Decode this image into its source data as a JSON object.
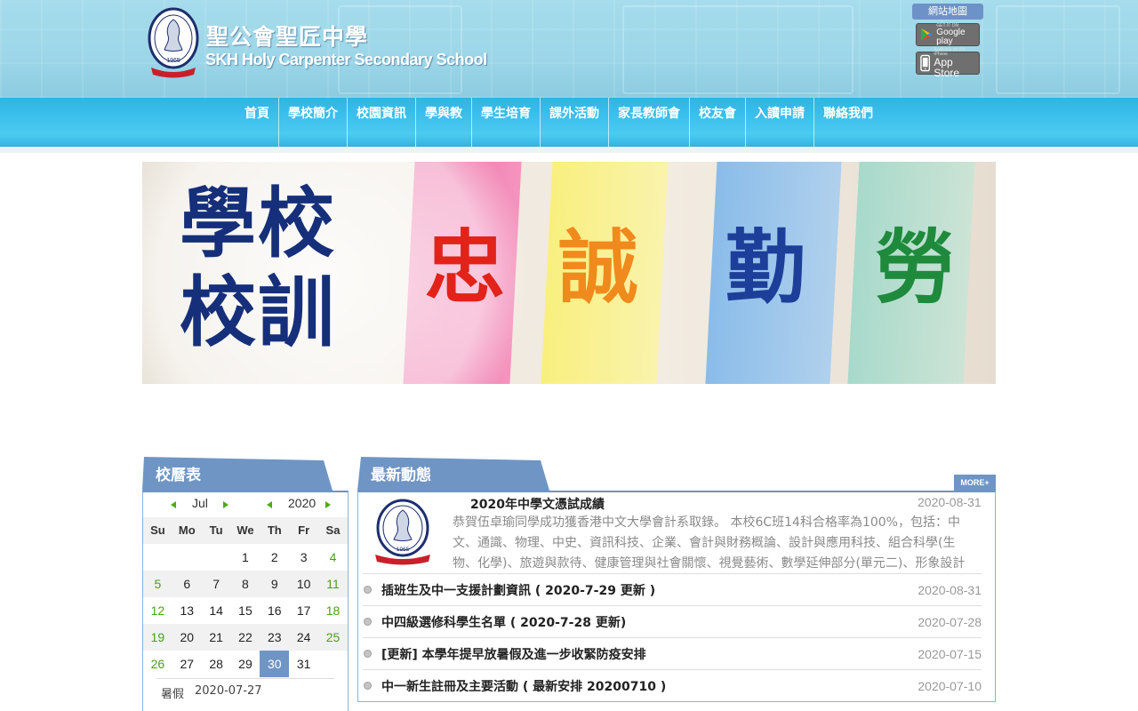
{
  "header": {
    "school_name_zh": "聖公會聖匠中學",
    "school_name_en": "SKH Holy Carpenter Secondary School",
    "badge_year": "1965",
    "sitemap_label": "網站地圖",
    "google_play": {
      "small": "GET IT ON",
      "big": "Google play"
    },
    "app_store": {
      "small": "Available on the iPhone",
      "big": "App Store"
    }
  },
  "nav": {
    "items": [
      "首頁",
      "學校簡介",
      "校園資訊",
      "學與教",
      "學生培育",
      "課外活動",
      "家長教師會",
      "校友會",
      "入讀申請",
      "聯絡我們"
    ]
  },
  "banner": {
    "title_line1": "學校",
    "title_line2": "校訓",
    "motto": [
      "忠",
      "誠",
      "勤",
      "勞"
    ],
    "motto_colors": [
      "#e2231a",
      "#f08a1c",
      "#1d3f9a",
      "#1f8a3c"
    ]
  },
  "calendar": {
    "title": "校曆表",
    "month": "Jul",
    "year": "2020",
    "weekdays": [
      "Su",
      "Mo",
      "Tu",
      "We",
      "Th",
      "Fr",
      "Sa"
    ],
    "weeks": [
      [
        "",
        "",
        "",
        "1",
        "2",
        "3",
        "4"
      ],
      [
        "5",
        "6",
        "7",
        "8",
        "9",
        "10",
        "11"
      ],
      [
        "12",
        "13",
        "14",
        "15",
        "16",
        "17",
        "18"
      ],
      [
        "19",
        "20",
        "21",
        "22",
        "23",
        "24",
        "25"
      ],
      [
        "26",
        "27",
        "28",
        "29",
        "30",
        "31",
        ""
      ]
    ],
    "today": "30",
    "event": {
      "name": "暑假",
      "date": "2020-07-27"
    }
  },
  "news": {
    "title": "最新動態",
    "more_label": "MORE+",
    "featured": {
      "title": "2020年中學文憑試成績",
      "date": "2020-08-31",
      "body": "恭賀伍卓瑜同學成功獲香港中文大學會計系取錄。 本校6C班14科合格率為100%，包括：中文、通識、物理、中史、資訊科技、企業、會計與財務概論、設計與應用科技、組合科學(生物、化學)、旅遊與款待、健康管理與社會關懷、視覺藝術、數學延伸部分(單元二)、形象設計(APL)及"
    },
    "items": [
      {
        "text": "插班生及中一支援計劃資訊 ( 2020-7-29 更新 )",
        "date": "2020-08-31"
      },
      {
        "text": "中四級選修科學生名單 ( 2020-7-28 更新)",
        "date": "2020-07-28"
      },
      {
        "text": "[更新] 本學年提早放暑假及進一步收緊防疫安排",
        "date": "2020-07-15"
      },
      {
        "text": "中一新生註冊及主要活動 ( 最新安排 20200710 )",
        "date": "2020-07-10"
      }
    ]
  }
}
